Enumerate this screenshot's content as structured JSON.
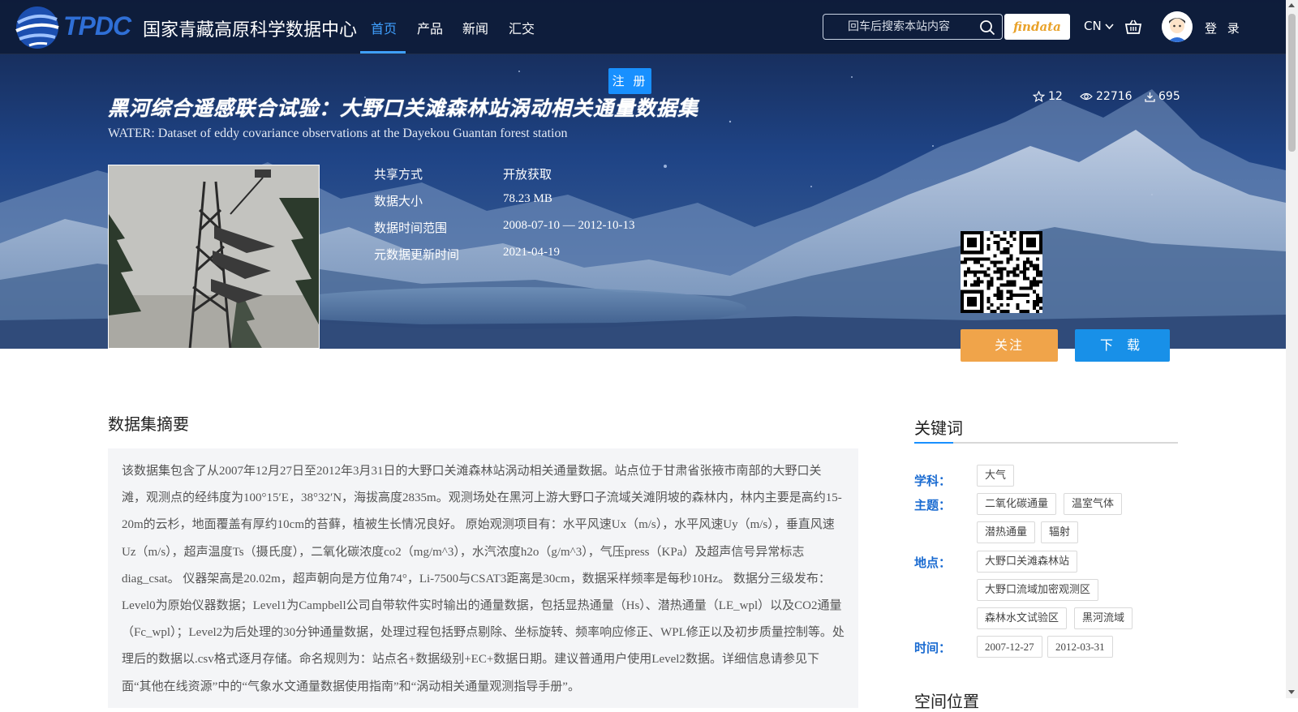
{
  "header": {
    "logo_text": "TPDC",
    "site_name": "国家青藏高原科学数据中心",
    "nav": [
      {
        "label": "首页",
        "active": true
      },
      {
        "label": "产品",
        "active": false
      },
      {
        "label": "新闻",
        "active": false
      },
      {
        "label": "汇交",
        "active": false
      }
    ],
    "search_placeholder": "回车后搜索本站内容",
    "findata_label": "findata",
    "lang_label": "CN",
    "login_label": "登 录"
  },
  "register_label": "注 册",
  "dataset": {
    "title_cn": "黑河综合遥感联合试验：大野口关滩森林站涡动相关通量数据集",
    "title_en": "WATER: Dataset of eddy covariance observations at the Dayekou Guantan forest station",
    "stats": {
      "stars": "12",
      "views": "22716",
      "downloads": "695"
    },
    "meta": [
      {
        "key": "共享方式",
        "value": "开放获取"
      },
      {
        "key": "数据大小",
        "value": "78.23 MB"
      },
      {
        "key": "数据时间范围",
        "value": "2008-07-10 — 2012-10-13"
      },
      {
        "key": "元数据更新时间",
        "value": "2021-04-19"
      }
    ],
    "follow_label": "关注",
    "download_label": "下 载"
  },
  "abstract": {
    "title": "数据集摘要",
    "text": "该数据集包含了从2007年12月27日至2012年3月31日的大野口关滩森林站涡动相关通量数据。站点位于甘肃省张掖市南部的大野口关滩，观测点的经纬度为100°15′E，38°32′N，海拔高度2835m。观测场处在黑河上游大野口子流域关滩阴坡的森林内，林内主要是高约15-20m的云杉，地面覆盖有厚约10cm的苔藓，植被生长情况良好。 原始观测项目有：水平风速Ux（m/s），水平风速Uy（m/s），垂直风速Uz（m/s），超声温度Ts（摄氏度），二氧化碳浓度co2（mg/m^3），水汽浓度h2o（g/m^3），气压press（KPa）及超声信号异常标志diag_csat。 仪器架高是20.02m，超声朝向是方位角74°，Li-7500与CSAT3距离是30cm，数据采样频率是每秒10Hz。 数据分三级发布：Level0为原始仪器数据；Level1为Campbell公司自带软件实时输出的通量数据，包括显热通量（Hs）、潜热通量（LE_wpl）以及CO2通量（Fc_wpl）；Level2为后处理的30分钟通量数据，处理过程包括野点剔除、坐标旋转、频率响应修正、WPL修正以及初步质量控制等。处理后的数据以.csv格式逐月存储。命名规则为：站点名+数据级别+EC+数据日期。建议普通用户使用Level2数据。详细信息请参见下面“其他在线资源”中的“气象水文通量数据使用指南”和“涡动相关通量观测指导手册”。"
  },
  "keywords": {
    "title": "关键词",
    "groups": [
      {
        "label": "学科：",
        "tags": [
          "大气"
        ]
      },
      {
        "label": "主题：",
        "tags": [
          "二氧化碳通量",
          "温室气体",
          "潜热通量",
          "辐射"
        ]
      },
      {
        "label": "地点：",
        "tags": [
          "大野口关滩森林站",
          "大野口流域加密观测区",
          "森林水文试验区",
          "黑河流域"
        ]
      },
      {
        "label": "时间：",
        "tags": [
          "2007-12-27",
          "2012-03-31"
        ]
      }
    ]
  },
  "space_title": "空间位置",
  "colors": {
    "accent": "#1890ff",
    "follow": "#f0a44a",
    "download": "#1890e8",
    "keyword_label": "#1a6bd1"
  }
}
